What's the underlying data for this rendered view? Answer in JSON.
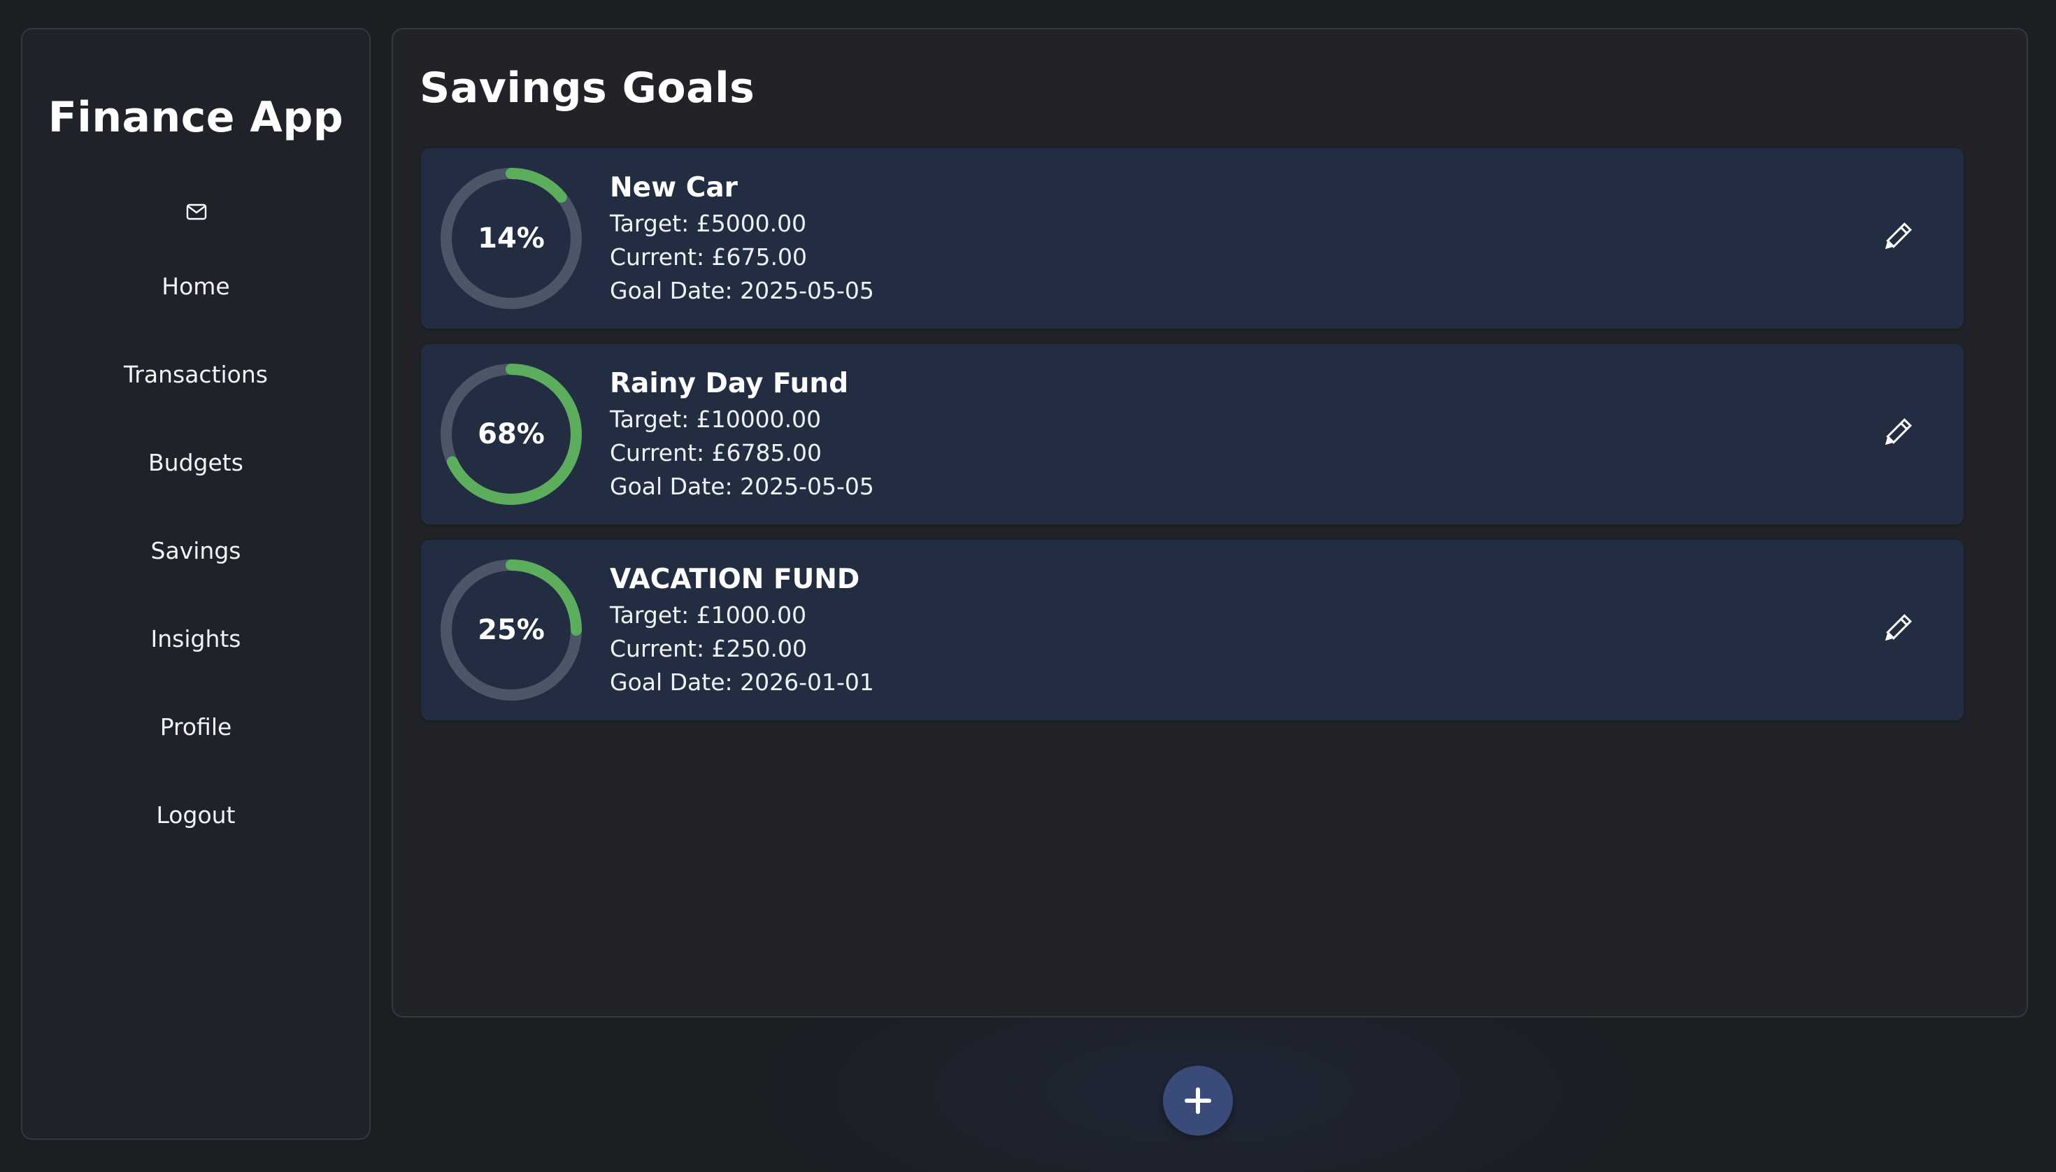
{
  "sidebar": {
    "app_title": "Finance App",
    "mail_icon": "envelope-icon",
    "nav_items": [
      {
        "label": "Home"
      },
      {
        "label": "Transactions"
      },
      {
        "label": "Budgets"
      },
      {
        "label": "Savings"
      },
      {
        "label": "Insights"
      },
      {
        "label": "Profile"
      },
      {
        "label": "Logout"
      }
    ]
  },
  "main": {
    "title": "Savings Goals",
    "goals": [
      {
        "name": "New Car",
        "percent_label": "14%",
        "progress": 0.14,
        "target": "Target: £5000.00",
        "current": "Current: £675.00",
        "goal_date": "Goal Date: 2025-05-05",
        "edit_icon": "pencil-icon"
      },
      {
        "name": "Rainy Day Fund",
        "percent_label": "68%",
        "progress": 0.68,
        "target": "Target: £10000.00",
        "current": "Current: £6785.00",
        "goal_date": "Goal Date: 2025-05-05",
        "edit_icon": "pencil-icon"
      },
      {
        "name": "VACATION FUND",
        "percent_label": "25%",
        "progress": 0.25,
        "target": "Target: £1000.00",
        "current": "Current: £250.00",
        "goal_date": "Goal Date: 2026-01-01",
        "edit_icon": "pencil-icon"
      }
    ]
  },
  "add_button": {
    "icon": "plus-icon"
  },
  "colors": {
    "background": "#1b1e23",
    "panel": "#212328",
    "sidebar": "#1f2228",
    "card": "#232d42",
    "progress": "#5cad5c",
    "track": "#4d5668",
    "accent_button": "#3a4b7a"
  }
}
